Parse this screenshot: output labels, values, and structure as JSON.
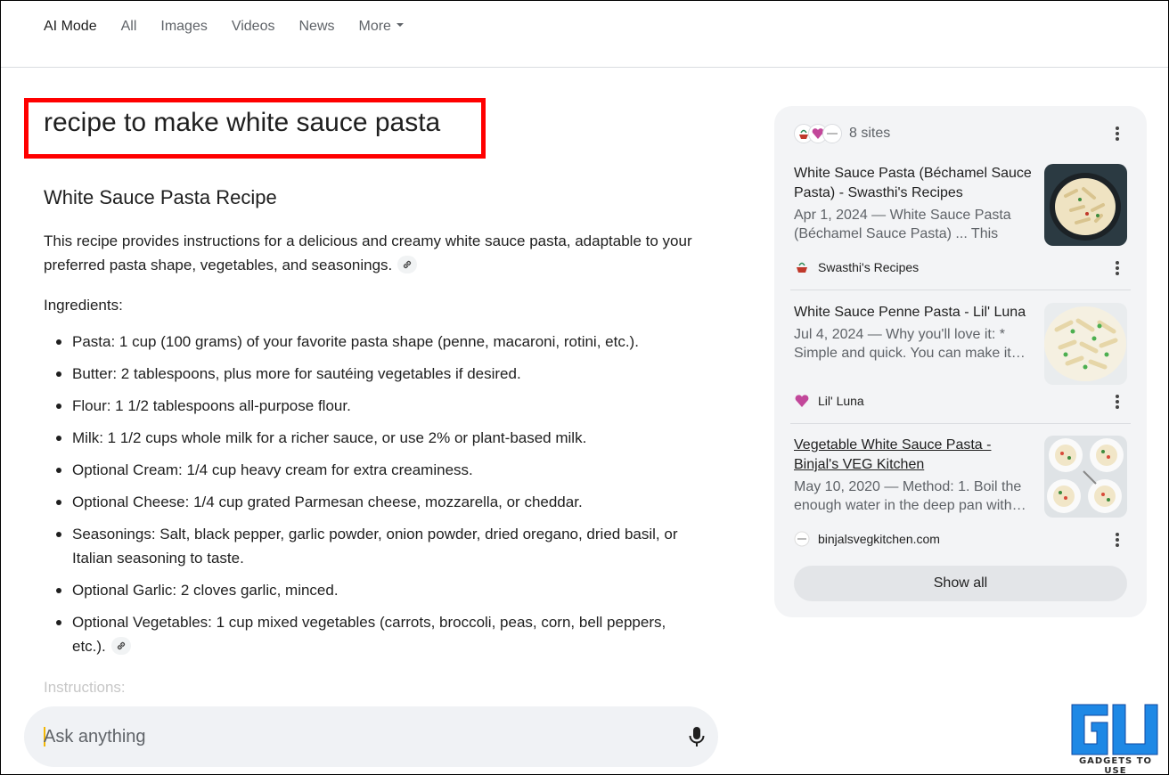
{
  "nav": {
    "tabs": [
      {
        "label": "AI Mode",
        "active": true
      },
      {
        "label": "All"
      },
      {
        "label": "Images"
      },
      {
        "label": "Videos"
      },
      {
        "label": "News"
      },
      {
        "label": "More"
      }
    ]
  },
  "query": "recipe to make white sauce pasta",
  "answer": {
    "heading": "White Sauce Pasta Recipe",
    "intro": "This recipe provides instructions for a delicious and creamy white sauce pasta, adaptable to your preferred pasta shape, vegetables, and seasonings.",
    "ingredients_label": "Ingredients:",
    "ingredients": [
      "Pasta: 1 cup (100 grams) of your favorite pasta shape (penne, macaroni, rotini, etc.).",
      "Butter: 2 tablespoons, plus more for sautéing vegetables if desired.",
      "Flour: 1 1/2 tablespoons all-purpose flour.",
      "Milk: 1 1/2 cups whole milk for a richer sauce, or use 2% or plant-based milk.",
      "Optional Cream: 1/4 cup heavy cream for extra creaminess.",
      "Optional Cheese: 1/4 cup grated Parmesan cheese, mozzarella, or cheddar.",
      "Seasonings: Salt, black pepper, garlic powder, onion powder, dried oregano, dried basil, or Italian seasoning to taste.",
      "Optional Garlic: 2 cloves garlic, minced.",
      "Optional Vegetables: 1 cup mixed vegetables (carrots, broccoli, peas, corn, bell peppers, etc.)."
    ],
    "instructions_label": "Instructions:"
  },
  "ask": {
    "placeholder": "Ask anything"
  },
  "sources": {
    "count_label": "8 sites",
    "items": [
      {
        "title": "White Sauce Pasta (Béchamel Sauce Pasta) - Swasthi's Recipes",
        "snippet": "Apr 1, 2024 — White Sauce Pasta (Béchamel Sauce Pasta) ... This Wh…",
        "source": "Swasthi's Recipes"
      },
      {
        "title": "White Sauce Penne Pasta - Lil' Luna",
        "snippet": "Jul 4, 2024 — Why you'll love it: * Simple and quick. You can make it…",
        "source": "Lil' Luna"
      },
      {
        "title": "Vegetable White Sauce Pasta - Binjal's VEG Kitchen",
        "snippet": "May 10, 2020 — Method: 1. Boil the enough water in the deep pan with…",
        "source": "binjalsvegkitchen.com"
      }
    ],
    "show_all_label": "Show all"
  },
  "watermark": {
    "text": "GADGETS TO USE"
  },
  "colors": {
    "highlight_border": "#ff0000",
    "panel_bg": "#f3f4f6",
    "muted_text": "#5f6368"
  }
}
